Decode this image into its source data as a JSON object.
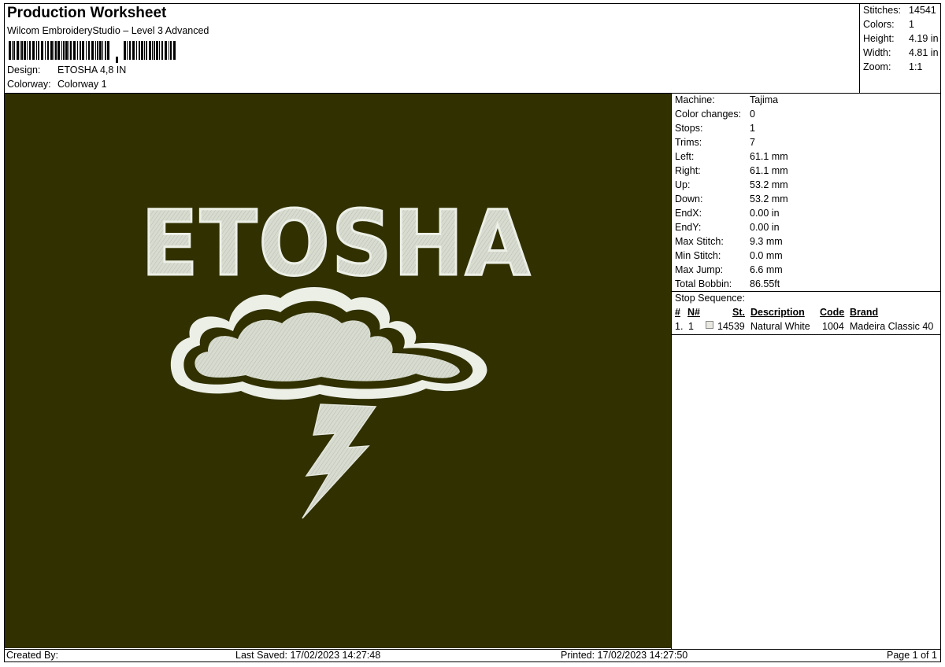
{
  "header": {
    "title": "Production Worksheet",
    "subtitle": "Wilcom EmbroideryStudio – Level 3 Advanced",
    "design_label": "Design:",
    "design_value": "ETOSHA 4,8 IN",
    "colorway_label": "Colorway:",
    "colorway_value": "Colorway 1"
  },
  "summary": {
    "stitches_label": "Stitches:",
    "stitches_value": "14541",
    "colors_label": "Colors:",
    "colors_value": "1",
    "height_label": "Height:",
    "height_value": "4.19 in",
    "width_label": "Width:",
    "width_value": "4.81 in",
    "zoom_label": "Zoom:",
    "zoom_value": "1:1"
  },
  "design": {
    "background_color": "#303000",
    "thread_color": "#d8dcd0",
    "text": "ETOSHA"
  },
  "machine_info": [
    {
      "label": "Machine:",
      "value": "Tajima"
    },
    {
      "label": "Color changes:",
      "value": "0"
    },
    {
      "label": "Stops:",
      "value": "1"
    },
    {
      "label": "Trims:",
      "value": "7"
    },
    {
      "label": "Left:",
      "value": "61.1 mm"
    },
    {
      "label": "Right:",
      "value": "61.1 mm"
    },
    {
      "label": "Up:",
      "value": "53.2 mm"
    },
    {
      "label": "Down:",
      "value": "53.2 mm"
    },
    {
      "label": "EndX:",
      "value": "0.00 in"
    },
    {
      "label": "EndY:",
      "value": "0.00 in"
    },
    {
      "label": "Max Stitch:",
      "value": "9.3 mm"
    },
    {
      "label": "Min Stitch:",
      "value": "0.0 mm"
    },
    {
      "label": "Max Jump:",
      "value": "6.6 mm"
    },
    {
      "label": "Total Bobbin:",
      "value": "86.55ft"
    }
  ],
  "stop_sequence": {
    "label": "Stop Sequence:",
    "columns": [
      "#",
      "N#",
      "St.",
      "Description",
      "Code",
      "Brand"
    ],
    "rows": [
      {
        "num": "1.",
        "n": "1",
        "stitches": "14539",
        "description": "Natural White",
        "code": "1004",
        "brand": "Madeira Classic 40",
        "swatch_color": "#e8e8e0"
      }
    ]
  },
  "footer": {
    "created_by": "Created By:",
    "last_saved": "Last Saved: 17/02/2023 14:27:48",
    "printed": "Printed: 17/02/2023 14:27:50",
    "page": "Page 1 of 1"
  }
}
